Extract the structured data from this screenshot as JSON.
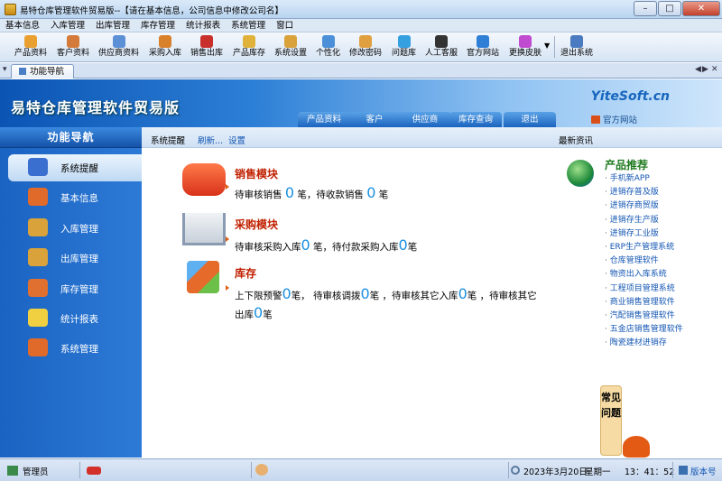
{
  "window": {
    "title": "易特仓库管理软件贸易版--【请在基本信息，公司信息中修改公司名】"
  },
  "menu": [
    "基本信息",
    "入库管理",
    "出库管理",
    "库存管理",
    "统计报表",
    "系统管理",
    "窗口"
  ],
  "toolbar": [
    {
      "label": "产品资料",
      "icon": "product-icon",
      "color": "#e9a030"
    },
    {
      "label": "客户资料",
      "icon": "customer-icon",
      "color": "#d47a3a"
    },
    {
      "label": "供应商资料",
      "icon": "supplier-icon",
      "color": "#5b8fd6"
    },
    {
      "label": "采购入库",
      "icon": "truck-icon",
      "color": "#d9802a"
    },
    {
      "label": "销售出库",
      "icon": "basket-icon",
      "color": "#c9302c"
    },
    {
      "label": "产品库存",
      "icon": "box-icon",
      "color": "#e0b23a"
    },
    {
      "label": "系统设置",
      "icon": "settings-icon",
      "color": "#d9a23a"
    },
    {
      "label": "个性化",
      "icon": "personalize-icon",
      "color": "#4a8fd8"
    },
    {
      "label": "修改密码",
      "icon": "key-icon",
      "color": "#e0a040"
    },
    {
      "label": "问题库",
      "icon": "qq-icon",
      "color": "#35a0e0"
    },
    {
      "label": "人工客服",
      "icon": "penguin-icon",
      "color": "#333333"
    },
    {
      "label": "官方网站",
      "icon": "ie-icon",
      "color": "#2f7fd6"
    },
    {
      "label": "更换皮肤",
      "icon": "skin-icon",
      "color": "#c04ad0"
    },
    {
      "label": "退出系统",
      "icon": "exit-icon",
      "color": "#4a7ac0"
    }
  ],
  "tab": {
    "label": "功能导航"
  },
  "banner": {
    "title": "易特仓库管理软件贸易版",
    "brand": "YiteSoft.cn",
    "nav": [
      "产品资料",
      "客户",
      "供应商",
      "库存查询",
      "退出"
    ],
    "official_site": "官方网站"
  },
  "sidebar": {
    "heading": "功能导航",
    "items": [
      {
        "label": "系统提醒",
        "icon": "info-icon",
        "color": "#3a6fd0"
      },
      {
        "label": "基本信息",
        "icon": "cubes-icon",
        "color": "#e06a2a"
      },
      {
        "label": "入库管理",
        "icon": "box-in-icon",
        "color": "#d9a23a"
      },
      {
        "label": "出库管理",
        "icon": "box-out-icon",
        "color": "#d9a23a"
      },
      {
        "label": "库存管理",
        "icon": "warehouse-icon",
        "color": "#e07030"
      },
      {
        "label": "统计报表",
        "icon": "chart-bubble-icon",
        "color": "#f0d040"
      },
      {
        "label": "系统管理",
        "icon": "system-icon",
        "color": "#e06a2a"
      }
    ]
  },
  "subbar": {
    "reminder": "系统提醒",
    "refresh": "刷新...",
    "settings": "设置",
    "news": "最新资讯"
  },
  "sales": {
    "heading": "销售模块",
    "p1": "待审核销售",
    "v1": "0",
    "p2": "笔，待收款销售",
    "v2": "0",
    "p3": "笔"
  },
  "purchase": {
    "heading": "采购模块",
    "p1": "待审核采购入库",
    "v1": "0",
    "p2": "笔，待付款采购入库",
    "v2": "0",
    "p3": "笔"
  },
  "stock": {
    "heading": "库存",
    "p1": "上下限预警",
    "v1": "0",
    "p2": "笔， 待审核调拨",
    "v2": "0",
    "p3": "笔 ，待审核其它入库",
    "v3": "0",
    "p4": "笔 ，待审核其它",
    "p5": "出库",
    "v4": "0",
    "p6": "笔"
  },
  "news": {
    "heading": "产品推荐",
    "items": [
      "手机新APP",
      "进销存普及版",
      "进销存商贸版",
      "进销存生产版",
      "进销存工业版",
      "ERP生产管理系统",
      "仓库管理软件",
      "物资出入库系统",
      "工程项目管理系统",
      "商业销售管理软件",
      "汽配销售管理软件",
      "五金店销售管理软件",
      "陶瓷建材进销存"
    ]
  },
  "faq": {
    "label": "常见问题"
  },
  "status": {
    "user": "管理员",
    "date": "2023年3月20日",
    "weekday": "星期一",
    "time": "13：41：52",
    "version": "版本号"
  }
}
